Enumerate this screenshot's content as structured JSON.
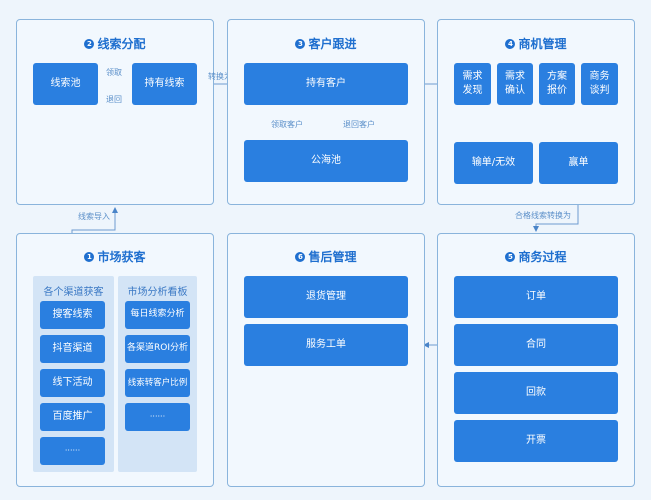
{
  "colors": {
    "background": "#eef5fc",
    "panel_border": "#8ab4dc",
    "box": "#2a7fe0",
    "title": "#1f6fcf",
    "connector": "#5b8fc9"
  },
  "panels": {
    "p2": {
      "badge": "2",
      "title": "线索分配",
      "boxes": [
        "线索池",
        "持有线索"
      ],
      "arrows": {
        "claim": "领取",
        "return": "退回"
      }
    },
    "p3": {
      "badge": "3",
      "title": "客户跟进",
      "boxes": [
        "持有客户",
        "公海池"
      ],
      "arrows": {
        "claim": "领取客户",
        "return": "退回客户"
      }
    },
    "p4": {
      "badge": "4",
      "title": "商机管理",
      "steps": [
        "需求\n发现",
        "需求\n确认",
        "方案\n报价",
        "商务\n谈判"
      ],
      "outcomes": [
        "输单/无效",
        "赢单"
      ]
    },
    "p1": {
      "badge": "1",
      "title": "市场获客",
      "columns": [
        {
          "header": "各个渠道获客",
          "items": [
            "搜客线索",
            "抖音渠道",
            "线下活动",
            "百度推广",
            "······"
          ]
        },
        {
          "header": "市场分析看板",
          "items": [
            "每日线索分析",
            "各渠道ROI分析",
            "线索转客户比例",
            "······"
          ]
        }
      ]
    },
    "p6": {
      "badge": "6",
      "title": "售后管理",
      "boxes": [
        "退货管理",
        "服务工单"
      ]
    },
    "p5": {
      "badge": "5",
      "title": "商务过程",
      "boxes": [
        "订单",
        "合同",
        "回款",
        "开票"
      ]
    }
  },
  "connectors": {
    "p2_to_p3": "转换为",
    "p1_to_p2": "线索导入",
    "p4_to_p5": "合格线索转换为"
  }
}
